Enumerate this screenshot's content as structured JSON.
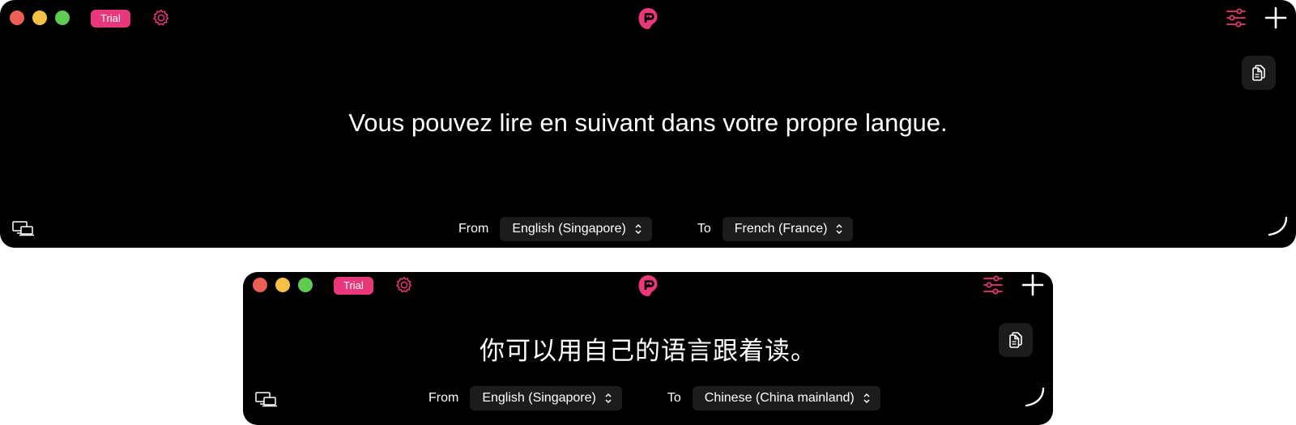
{
  "colors": {
    "accent": "#e8377a",
    "window_bg": "#000000",
    "control_bg": "#1c1c1e"
  },
  "icons": [
    "gear-icon",
    "app-logo-icon",
    "filter-sliders-icon",
    "plus-icon",
    "copy-icon",
    "screens-icon",
    "resize-corner-icon",
    "chevron-updown-icon"
  ],
  "windows": [
    {
      "trial_label": "Trial",
      "translation_text": "Vous pouvez lire en suivant dans votre propre langue.",
      "from_label": "From",
      "from_language": "English (Singapore)",
      "to_label": "To",
      "to_language": "French (France)"
    },
    {
      "trial_label": "Trial",
      "translation_text": "你可以用自己的语言跟着读。",
      "from_label": "From",
      "from_language": "English (Singapore)",
      "to_label": "To",
      "to_language": "Chinese (China mainland)"
    }
  ]
}
